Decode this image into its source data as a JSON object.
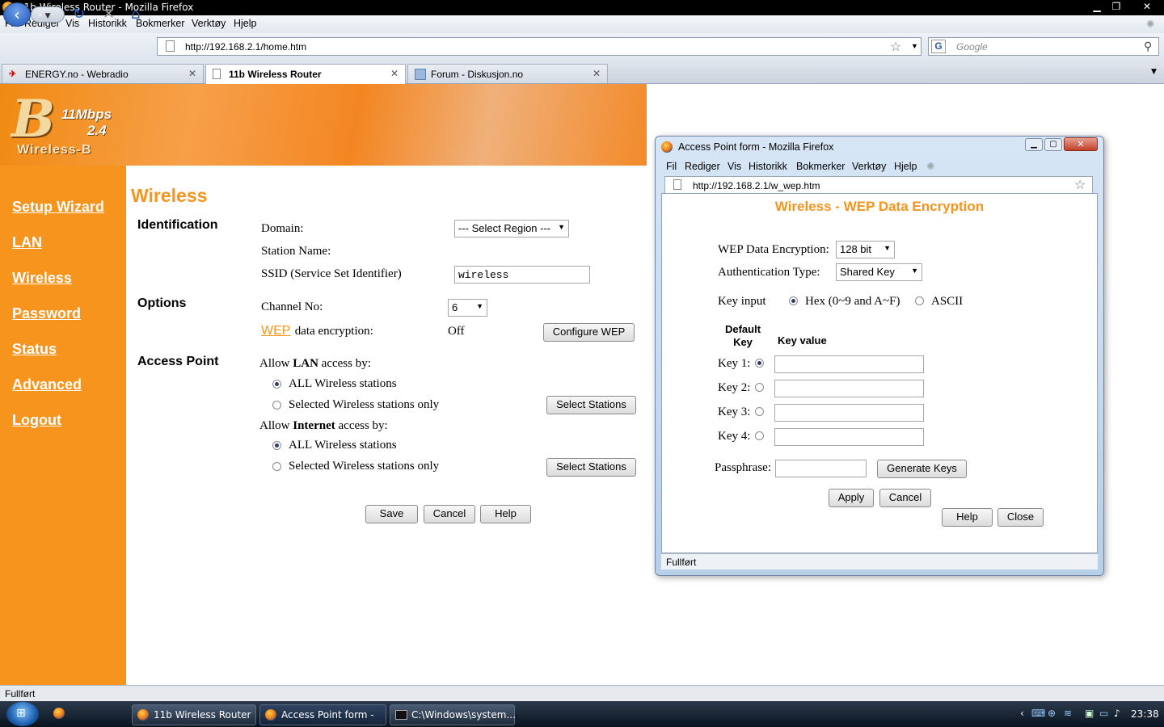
{
  "window": {
    "title": "11b Wireless Router - Mozilla Firefox"
  },
  "menu": [
    "Fil",
    "Rediger",
    "Vis",
    "Historikk",
    "Bokmerker",
    "Verktøy",
    "Hjelp"
  ],
  "address": {
    "url": "http://192.168.2.1/home.htm"
  },
  "search": {
    "placeholder": "Google"
  },
  "tabs": [
    {
      "label": "ENERGY.no - Webradio"
    },
    {
      "label": "11b Wireless Router"
    },
    {
      "label": "Forum - Diskusjon.no"
    }
  ],
  "logo": {
    "letter": "B",
    "speed": "11Mbps",
    "version": "2.4",
    "brand": "Wireless-B"
  },
  "sidebar": [
    "Setup Wizard",
    "LAN",
    "Wireless",
    "Password",
    "Status",
    "Advanced",
    "Logout"
  ],
  "main": {
    "title": "Wireless",
    "sections": {
      "identification": "Identification",
      "options": "Options",
      "access_point": "Access Point"
    },
    "domain_label": "Domain:",
    "domain_value": "--- Select Region ---",
    "station_name_label": "Station Name:",
    "ssid_label": "SSID (Service Set Identifier)",
    "ssid_value": "wireless",
    "channel_label": "Channel No:",
    "channel_value": "6",
    "wep_link": "WEP",
    "wep_label": " data encryption:",
    "wep_value": "Off",
    "configure_wep": "Configure WEP",
    "lan_access_pre": "Allow ",
    "lan_access_bold": "LAN",
    "lan_access_post": " access by:",
    "internet_access_pre": "Allow ",
    "internet_access_bold": "Internet",
    "internet_access_post": " access by:",
    "all_stations": "ALL Wireless stations",
    "selected_stations": "Selected Wireless stations only",
    "select_stations": "Select Stations",
    "save": "Save",
    "cancel": "Cancel",
    "help": "Help"
  },
  "status": "Fullført",
  "popup": {
    "title": "Access Point form - Mozilla Firefox",
    "menu": [
      "Fil",
      "Rediger",
      "Vis",
      "Historikk",
      "Bokmerker",
      "Verktøy",
      "Hjelp"
    ],
    "url": "http://192.168.2.1/w_wep.htm",
    "heading": "Wireless - WEP Data Encryption",
    "encryption_label": "WEP Data Encryption:",
    "encryption_value": "128 bit",
    "auth_label": "Authentication Type:",
    "auth_value": "Shared Key",
    "key_input_label": "Key input",
    "hex_label": "Hex (0~9 and A~F)",
    "ascii_label": "ASCII",
    "default_key_header": "Default Key",
    "key_value_header": "Key value",
    "keys": [
      "Key 1:",
      "Key 2:",
      "Key 3:",
      "Key 4:"
    ],
    "passphrase_label": "Passphrase:",
    "generate_keys": "Generate Keys",
    "apply": "Apply",
    "cancel": "Cancel",
    "help": "Help",
    "close": "Close",
    "status": "Fullført"
  },
  "taskbar": {
    "items": [
      "11b Wireless Router ...",
      "Access Point form - ...",
      "C:\\Windows\\system..."
    ],
    "clock": "23:38"
  },
  "colors": {
    "accent_orange": "#f7941d",
    "sidebar": "#f7941d",
    "heading": "#f7941d",
    "taskbar": "#0b1420"
  }
}
